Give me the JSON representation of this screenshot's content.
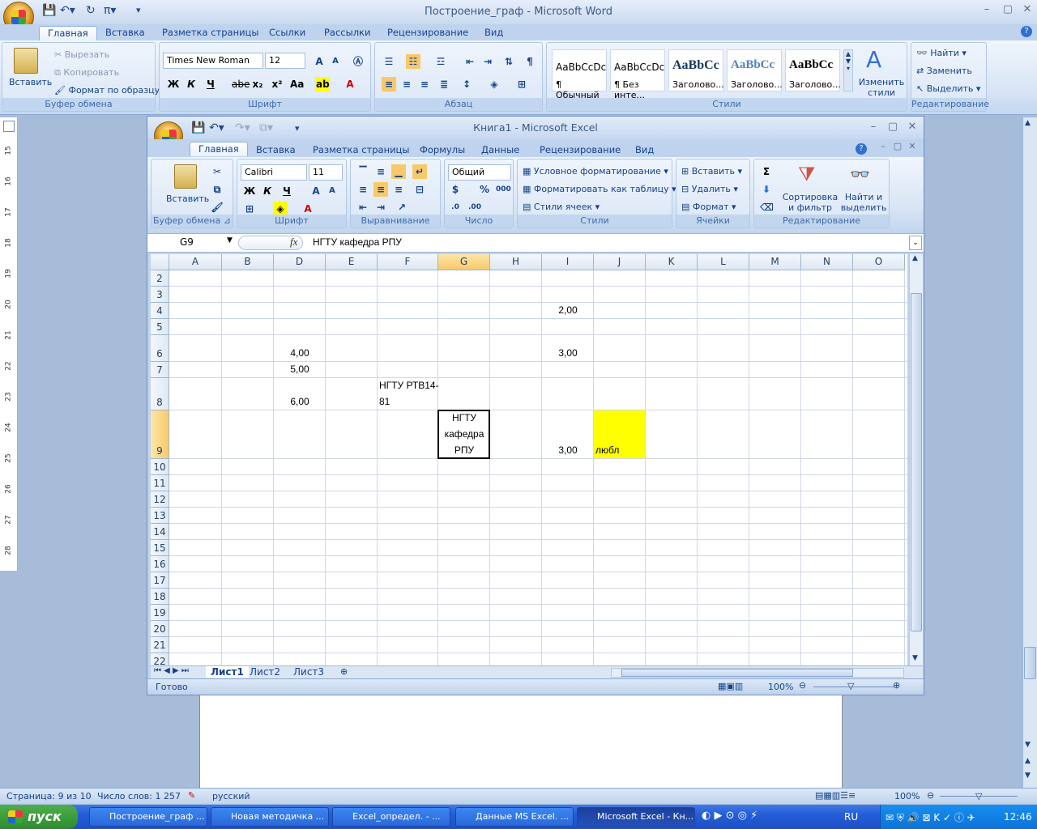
{
  "word": {
    "title": "Построение_граф - Microsoft Word",
    "tabs": [
      "Главная",
      "Вставка",
      "Разметка страницы",
      "Ссылки",
      "Рассылки",
      "Рецензирование",
      "Вид"
    ],
    "clipboard": {
      "paste": "Вставить",
      "cut": "Вырезать",
      "copy": "Копировать",
      "format_painter": "Формат по образцу",
      "label": "Буфер обмена"
    },
    "font": {
      "name": "Times New Roman",
      "size": "12",
      "label": "Шрифт",
      "bold": "Ж",
      "italic": "К",
      "underline": "Ч",
      "strike": "abe"
    },
    "paragraph_label": "Абзац",
    "styles": {
      "items": [
        {
          "preview": "AaBbCcDc",
          "name": "¶ Обычный"
        },
        {
          "preview": "AaBbCcDc",
          "name": "¶ Без инте..."
        },
        {
          "preview": "AaBbCc",
          "name": "Заголово..."
        },
        {
          "preview": "AaBbCc",
          "name": "Заголово..."
        },
        {
          "preview": "AaBbCc",
          "name": "Заголово..."
        }
      ],
      "change": "Изменить стили",
      "label": "Стили"
    },
    "editing": {
      "find": "Найти",
      "replace": "Заменить",
      "select": "Выделить",
      "label": "Редактирование"
    },
    "status": {
      "page": "Страница: 9 из 10",
      "words": "Число слов: 1 257",
      "lang": "русский",
      "zoom": "100%"
    },
    "ruler": [
      "15",
      "16",
      "17",
      "18",
      "19",
      "20",
      "21",
      "22",
      "23",
      "24",
      "25",
      "26",
      "27",
      "28"
    ]
  },
  "excel": {
    "title": "Книга1 - Microsoft Excel",
    "tabs": [
      "Главная",
      "Вставка",
      "Разметка страницы",
      "Формулы",
      "Данные",
      "Рецензирование",
      "Вид"
    ],
    "clipboard": {
      "paste": "Вставить",
      "label": "Буфер обмена"
    },
    "font": {
      "name": "Calibri",
      "size": "11",
      "label": "Шрифт",
      "bold": "Ж",
      "italic": "К",
      "underline": "Ч"
    },
    "alignment_label": "Выравнивание",
    "number": {
      "format": "Общий",
      "label": "Число"
    },
    "styles": {
      "conditional": "Условное форматирование",
      "as_table": "Форматировать как таблицу",
      "cell_styles": "Стили ячеек",
      "label": "Стили"
    },
    "cells": {
      "insert": "Вставить",
      "delete": "Удалить",
      "format": "Формат",
      "label": "Ячейки"
    },
    "editing": {
      "sort": "Сортировка и фильтр",
      "find": "Найти и выделить",
      "label": "Редактирование"
    },
    "name_box": "G9",
    "formula": "НГТУ кафедра РПУ",
    "columns": [
      "A",
      "B",
      "D",
      "E",
      "F",
      "G",
      "H",
      "I",
      "J",
      "K",
      "L",
      "M",
      "N",
      "O"
    ],
    "rows": [
      "2",
      "3",
      "4",
      "5",
      "6",
      "7",
      "8",
      "9",
      "10",
      "11",
      "12",
      "13",
      "14",
      "15",
      "16",
      "17",
      "18",
      "19",
      "20",
      "21",
      "22"
    ],
    "cells_data": {
      "I4": "2,00",
      "D6": "4,00",
      "I6": "3,00",
      "D7": "5,00",
      "F8a": "НГТУ РТВ14-",
      "F8b": "81",
      "D8": "6,00",
      "G9a": "НГТУ",
      "G9b": "кафедра",
      "G9c": "РПУ",
      "I9": "3,00",
      "J9": "любл"
    },
    "highlight_color": "#ffff00",
    "sheets": [
      "Лист1",
      "Лист2",
      "Лист3"
    ],
    "status": {
      "ready": "Готово",
      "zoom": "100%"
    }
  },
  "taskbar": {
    "start": "пуск",
    "items": [
      "Построение_граф ...",
      "Новая методичка ...",
      "Excel_определ. - ...",
      "Данные MS Excel. ...",
      "Microsoft Excel - Кн..."
    ],
    "lang": "RU",
    "time": "12:46"
  }
}
